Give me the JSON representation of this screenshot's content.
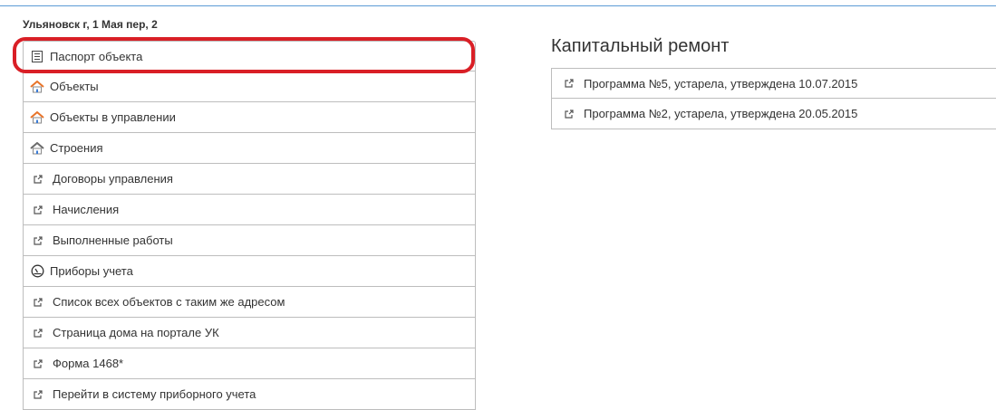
{
  "header": {
    "address": "Ульяновск г, 1 Мая пер, 2"
  },
  "sidebar": {
    "items": [
      {
        "label": "Паспорт объекта",
        "icon": "document-icon"
      },
      {
        "label": "Объекты",
        "icon": "house-icon"
      },
      {
        "label": "Объекты в управлении",
        "icon": "house-icon"
      },
      {
        "label": "Строения",
        "icon": "house-icon"
      },
      {
        "label": "Договоры управления",
        "icon": "external-link-icon"
      },
      {
        "label": "Начисления",
        "icon": "external-link-icon"
      },
      {
        "label": "Выполненные работы",
        "icon": "external-link-icon"
      },
      {
        "label": "Приборы учета",
        "icon": "gauge-icon"
      },
      {
        "label": "Список всех объектов с таким же адресом",
        "icon": "external-link-icon"
      },
      {
        "label": "Страница дома на портале УК",
        "icon": "external-link-icon"
      },
      {
        "label": "Форма 1468*",
        "icon": "external-link-icon"
      },
      {
        "label": "Перейти в систему приборного учета",
        "icon": "external-link-icon"
      }
    ]
  },
  "main": {
    "title": "Капитальный ремонт",
    "programs": [
      {
        "label": "Программа №5, устарела, утверждена 10.07.2015",
        "icon": "external-link-icon"
      },
      {
        "label": "Программа №2, устарела, утверждена 20.05.2015",
        "icon": "external-link-icon"
      }
    ]
  },
  "colors": {
    "highlight": "#d91f26",
    "border": "#bdbdbd",
    "top_line": "#5b9bd5",
    "roof": "#e8742a"
  }
}
